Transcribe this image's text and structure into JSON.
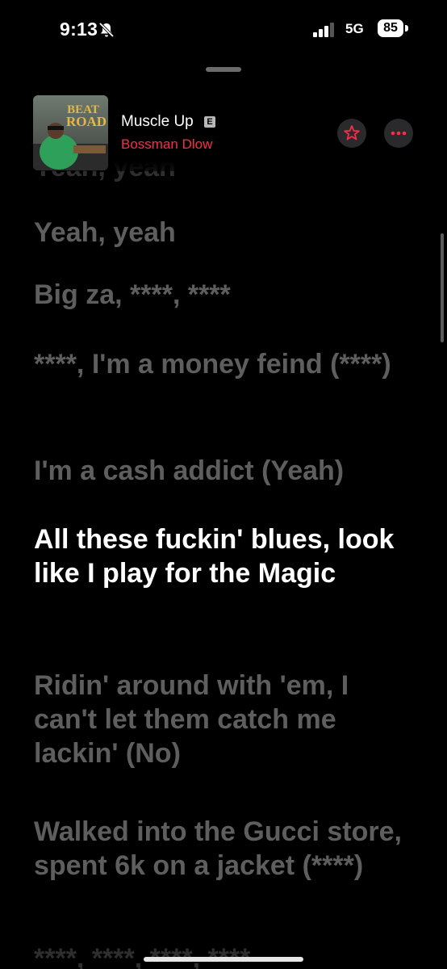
{
  "status_bar": {
    "time": "9:13",
    "network": "5G",
    "battery": "85"
  },
  "now_playing": {
    "title": "Muscle Up",
    "explicit": "E",
    "artist": "Bossman Dlow",
    "artist_color": "#fa2d48"
  },
  "lyrics": [
    {
      "text": "Yeah, yeah",
      "state": "faded"
    },
    {
      "text": "Yeah, yeah",
      "state": "past"
    },
    {
      "text": "Big za, ****, ****",
      "state": "past"
    },
    {
      "text": "****, I'm a money feind (****)",
      "state": "past"
    },
    {
      "text": "I'm a cash addict (Yeah)",
      "state": "past"
    },
    {
      "text": "All these fuckin' blues, look like I play for the Magic",
      "state": "active"
    },
    {
      "text": "Ridin' around with 'em, I can't let them catch me lackin' (No)",
      "state": "upcoming"
    },
    {
      "text": "Walked into the Gucci store, spent 6k on a jacket (****)",
      "state": "upcoming"
    },
    {
      "text": "****, ****, ****, ****",
      "state": "faded"
    }
  ],
  "icons": {
    "silent": "bell-slash-icon",
    "signal": "cellular-signal-icon",
    "favorite": "star-icon",
    "more": "ellipsis-icon"
  }
}
